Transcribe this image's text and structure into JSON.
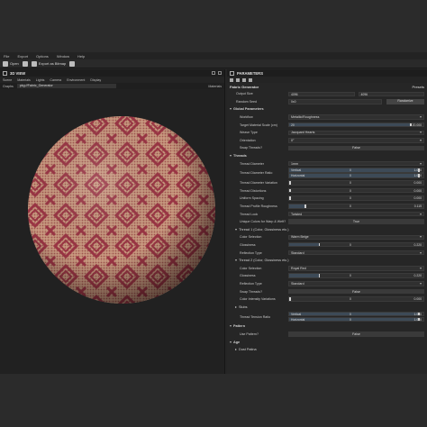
{
  "menubar": [
    "File",
    "Export",
    "Options",
    "Window",
    "Help"
  ],
  "toolbar": {
    "open": "Open",
    "export": "Export as Bitmap"
  },
  "view": {
    "title": "3D VIEW",
    "menu": [
      "Scene",
      "Materials",
      "Lights",
      "Camera",
      "Environment",
      "Display"
    ],
    "graph_label": "Graphs",
    "graph_value": "pkg://Fabric_Generator",
    "materials_label": "Materials"
  },
  "params": {
    "title": "PARAMETERS",
    "generator": "Fabric Generator",
    "presets": "Presets",
    "output_size": {
      "label": "Output Size",
      "w": "4096",
      "h": "4096"
    },
    "random_seed": {
      "label": "Random Seed",
      "value": "0x0",
      "button": "Randomize"
    },
    "global": {
      "title": "Global Parameters",
      "workflow": {
        "label": "Workflow",
        "value": "Metallic/Roughness"
      },
      "tms": {
        "label": "Target Material Scale (cm)",
        "min": "20",
        "max": "20.000"
      },
      "weave": {
        "label": "Weave Type",
        "value": "Jacquard Hearts"
      },
      "orient": {
        "label": "Orientation",
        "value": "0°"
      },
      "swap": {
        "label": "Swap Threads?",
        "value": "False"
      }
    },
    "threads": {
      "title": "Threads",
      "diam": {
        "label": "Thread Diameter",
        "value": "1mm"
      },
      "ratio": {
        "label": "Thread Diameter Ratio",
        "v_lbl": "Vertical",
        "v": "1.000",
        "h_lbl": "Horizontal",
        "h": "1.000",
        "vl": "0",
        "hl": "0"
      },
      "var": {
        "label": "Thread Diameter Variation",
        "value": "0.000",
        "l": "0"
      },
      "dist": {
        "label": "Thread Distortions",
        "value": "0.000",
        "l": "0"
      },
      "uni": {
        "label": "Uniform Spacing",
        "value": "0.000",
        "l": "0"
      },
      "prof": {
        "label": "Thread Profile Roughness",
        "value": "0.115",
        "l": "0"
      },
      "look": {
        "label": "Thread Look",
        "value": "Twisted"
      },
      "unique": {
        "label": "Unique Colors for Warp & Weft?",
        "value": "True"
      }
    },
    "t1": {
      "title": "Thread 1 (Color, Glossiness etc.)",
      "color": {
        "label": "Color Selection",
        "value": "Warm Beige"
      },
      "gloss": {
        "label": "Glossiness",
        "value": "0.220",
        "l": "0"
      },
      "refl": {
        "label": "Reflection Type",
        "value": "Standard"
      }
    },
    "t2": {
      "title": "Thread 2 (Color, Glossiness etc.)",
      "color": {
        "label": "Color Selection",
        "value": "Royal Red"
      },
      "gloss": {
        "label": "Glossiness",
        "value": "0.220",
        "l": "0"
      },
      "refl": {
        "label": "Reflection Type",
        "value": "Standard"
      },
      "swap": {
        "label": "Swap Threads?",
        "value": "False"
      },
      "civ": {
        "label": "Color Intensity Variations",
        "value": "0.000",
        "l": "0"
      }
    },
    "slubs": {
      "title": "Slubs"
    },
    "tension": {
      "label": "Thread Tension Ratio",
      "v_lbl": "Vertical",
      "v": "1.000",
      "h_lbl": "Horizontal",
      "h": "1.000",
      "vl": "0",
      "hl": "0"
    },
    "pattern": {
      "title": "Pattern",
      "use": {
        "label": "Use Pattern?",
        "value": "False"
      }
    },
    "age": {
      "title": "Age",
      "dust": {
        "title": "Dust Patina"
      }
    }
  },
  "colors": {
    "thread1": "#d9b89a",
    "thread2": "#9a3544"
  }
}
